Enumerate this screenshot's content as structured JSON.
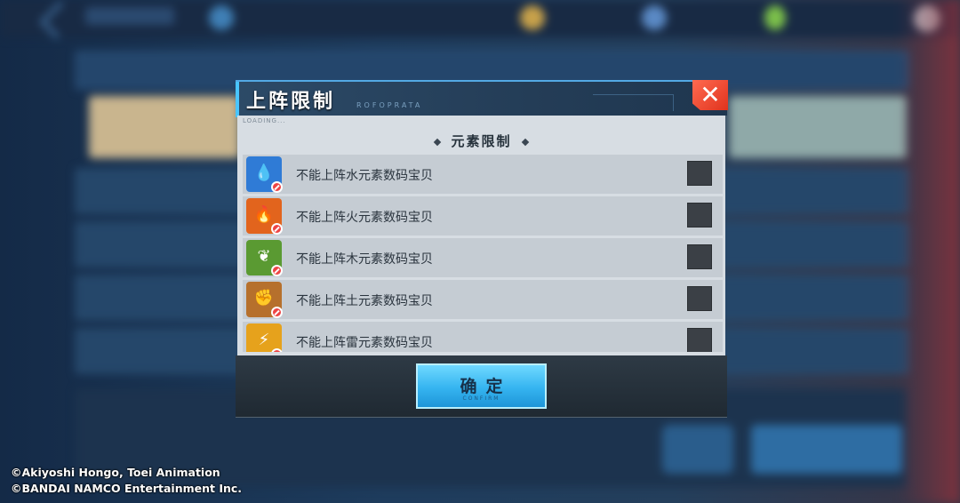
{
  "dialog": {
    "title": "上阵限制",
    "subtitle": "ROFOPRATA",
    "loading_text": "LOADING...",
    "section_title": "元素限制",
    "close_label": "✕",
    "items": [
      {
        "label": "不能上阵水元素数码宝贝",
        "icon": "water-element-icon",
        "color": "#2f7bd6",
        "glyph": "💧"
      },
      {
        "label": "不能上阵火元素数码宝贝",
        "icon": "fire-element-icon",
        "color": "#e2641d",
        "glyph": "🔥"
      },
      {
        "label": "不能上阵木元素数码宝贝",
        "icon": "wood-element-icon",
        "color": "#5a9a32",
        "glyph": "❦"
      },
      {
        "label": "不能上阵土元素数码宝贝",
        "icon": "earth-element-icon",
        "color": "#b6702c",
        "glyph": "✊"
      },
      {
        "label": "不能上阵雷元素数码宝贝",
        "icon": "thunder-element-icon",
        "color": "#e6a21c",
        "glyph": "⚡"
      }
    ],
    "confirm_label": "确定",
    "confirm_sub": "CONFIRM"
  },
  "copyright": {
    "line1": "©Akiyoshi Hongo, Toei Animation",
    "line2": "©BANDAI NAMCO Entertainment Inc."
  }
}
